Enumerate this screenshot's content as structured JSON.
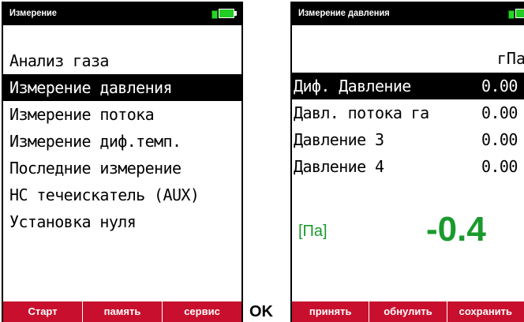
{
  "left_screen": {
    "title": "Измерение",
    "battery_icon": "battery-plugged-icon",
    "menu": [
      {
        "label": "Анализ газа",
        "selected": false
      },
      {
        "label": "Измерение давления",
        "selected": true
      },
      {
        "label": "Измерение потока",
        "selected": false
      },
      {
        "label": "Измерение диф.темп.",
        "selected": false
      },
      {
        "label": "Последние измерение",
        "selected": false
      },
      {
        "label": "HC течеискатель (AUX)",
        "selected": false
      },
      {
        "label": "Установка нуля",
        "selected": false
      }
    ],
    "softkeys": [
      "Старт",
      "память",
      "сервис"
    ]
  },
  "ok_label": "OK",
  "right_screen": {
    "title": "Измерение давления",
    "battery_icon": "battery-plugged-icon",
    "unit_header": "гПа",
    "rows": [
      {
        "label": "Диф. Давление",
        "value": "0.00",
        "selected": true
      },
      {
        "label": "Давл. потока га",
        "value": "0.00",
        "selected": false
      },
      {
        "label": "Давление 3",
        "value": "0.00",
        "selected": false
      },
      {
        "label": "Давление 4",
        "value": "0.00",
        "selected": false
      }
    ],
    "unit_label": "[Па]",
    "big_value": "-0.4",
    "softkeys": [
      "принять",
      "обнулить",
      "сохранить"
    ]
  },
  "colors": {
    "softkey_bar": "#c8102e",
    "value_green": "#1a9a2e",
    "battery_green": "#22cc22"
  }
}
